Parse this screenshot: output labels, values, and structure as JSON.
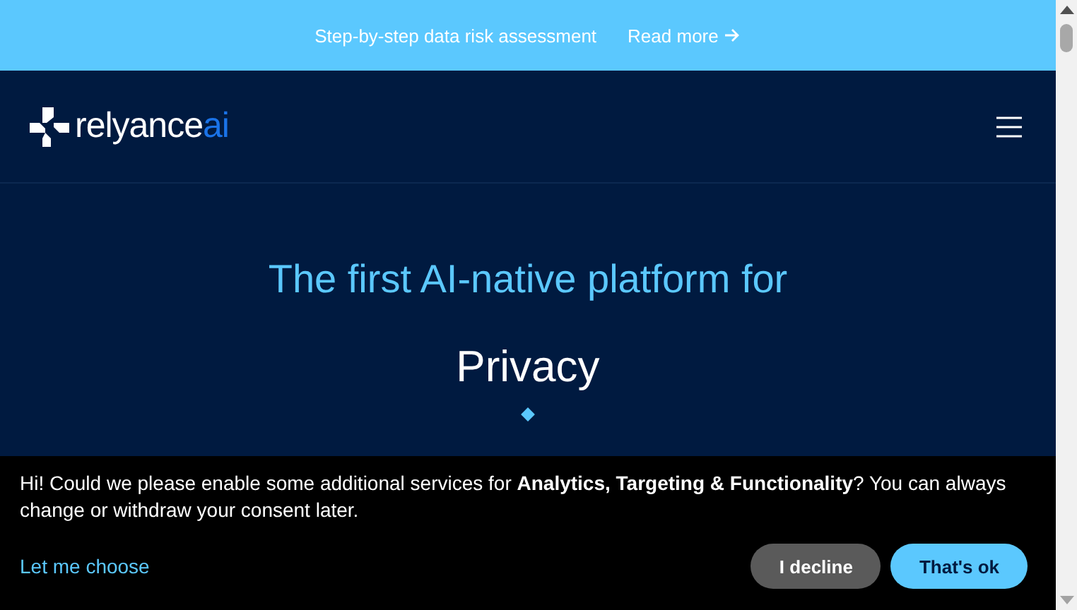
{
  "announcement": {
    "text": "Step-by-step data risk assessment",
    "link": "Read more"
  },
  "header": {
    "logo": {
      "name": "relyance",
      "accent": "ai"
    }
  },
  "hero": {
    "title": "The first AI-native platform for",
    "items": [
      "Privacy"
    ]
  },
  "cookie_banner": {
    "text": "Hi! Could we please enable some additional services for **Analytics, Targeting & Functionality**? You can always change or withdraw your consent later.",
    "link": "Let me choose",
    "buttons": [
      {
        "label": "I decline",
        "kind": "secondary"
      },
      {
        "label": "That's ok",
        "kind": "primary"
      }
    ]
  }
}
